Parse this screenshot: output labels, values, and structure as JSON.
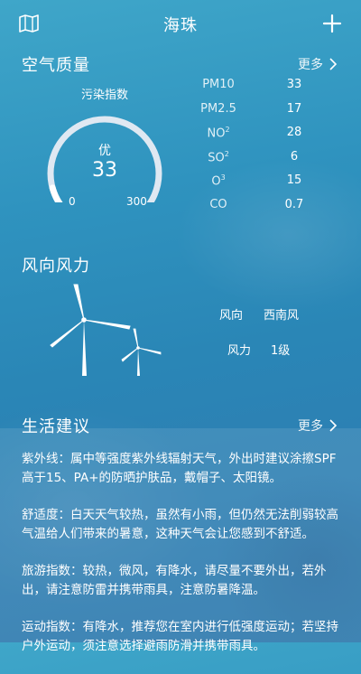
{
  "header": {
    "title": "海珠",
    "map_icon": "map-icon",
    "add_icon": "plus-icon"
  },
  "air_quality": {
    "title": "空气质量",
    "more_label": "更多",
    "index_label": "污染指数",
    "quality": "优",
    "aqi": 33,
    "aqi_min": "0",
    "aqi_max": "300",
    "pollutants": [
      {
        "name": "PM10",
        "sub": "",
        "value": "33"
      },
      {
        "name": "PM2.5",
        "sub": "",
        "value": "17"
      },
      {
        "name": "NO",
        "sub": "2",
        "value": "28"
      },
      {
        "name": "SO",
        "sub": "2",
        "value": "6"
      },
      {
        "name": "O",
        "sub": "3",
        "value": "15"
      },
      {
        "name": "CO",
        "sub": "",
        "value": "0.7"
      }
    ]
  },
  "wind": {
    "title": "风向风力",
    "direction_label": "风向",
    "direction_value": "西南风",
    "level_label": "风力",
    "level_value": "1级"
  },
  "advice": {
    "title": "生活建议",
    "more_label": "更多",
    "items": [
      {
        "text": "紫外线：属中等强度紫外线辐射天气，外出时建议涂擦SPF高于15、PA+的防晒护肤品，戴帽子、太阳镜。"
      },
      {
        "text": "舒适度：白天天气较热，虽然有小雨，但仍然无法削弱较高气温给人们带来的暑意，这种天气会让您感到不舒适。"
      },
      {
        "text": "旅游指数：较热，微风，有降水，请尽量不要外出，若外出，请注意防雷并携带雨具，注意防暑降温。"
      },
      {
        "text": "运动指数：有降水，推荐您在室内进行低强度运动；若坚持户外运动，须注意选择避雨防滑并携带雨具。"
      }
    ]
  },
  "colors": {
    "gauge_track": "#dfe8f2",
    "text": "#ffffff"
  }
}
